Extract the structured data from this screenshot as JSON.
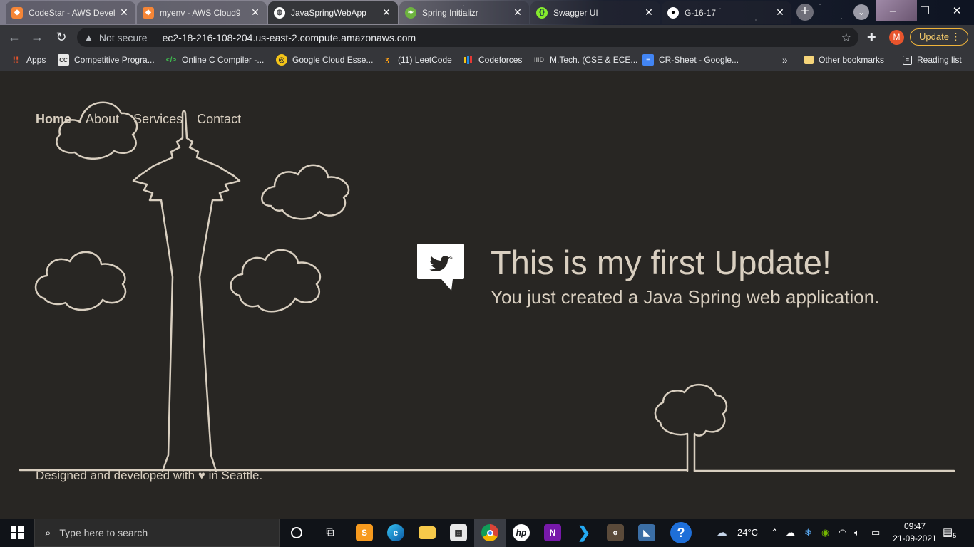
{
  "browser": {
    "tabs": [
      {
        "label": "CodeStar - AWS Devel",
        "icon": "aws-cube-icon",
        "color": "#f58536",
        "active": false
      },
      {
        "label": "myenv - AWS Cloud9",
        "icon": "aws-cube-icon",
        "color": "#f58536",
        "active": false
      },
      {
        "label": "JavaSpringWebApp",
        "icon": "globe-icon",
        "color": "#ffffff",
        "active": true
      },
      {
        "label": "Spring Initializr",
        "icon": "spring-leaf-icon",
        "color": "#6db33f",
        "active": false
      },
      {
        "label": "Swagger UI",
        "icon": "swagger-icon",
        "color": "#85ea2d",
        "active": false
      },
      {
        "label": "G-16-17",
        "icon": "github-icon",
        "color": "#ffffff",
        "active": false
      }
    ],
    "new_tab": "+",
    "window_controls": {
      "minimize": "–",
      "maximize": "❐",
      "close": "✕"
    },
    "address": {
      "security_label": "Not secure",
      "url": "ec2-18-216-108-204.us-east-2.compute.amazonaws.com"
    },
    "profile_initial": "M",
    "update_label": "Update",
    "bookmarks": [
      {
        "label": "Apps",
        "icon": "apps-grid-icon"
      },
      {
        "label": "Competitive Progra...",
        "icon": "cc-icon"
      },
      {
        "label": "Online C Compiler -...",
        "icon": "code-brackets-icon"
      },
      {
        "label": "Google Cloud Esse...",
        "icon": "qwiklabs-icon"
      },
      {
        "label": "(11) LeetCode",
        "icon": "leetcode-icon"
      },
      {
        "label": "Codeforces",
        "icon": "codeforces-icon"
      },
      {
        "label": "M.Tech. (CSE & ECE...",
        "icon": "iiitd-icon"
      },
      {
        "label": "CR-Sheet - Google...",
        "icon": "google-sheets-icon"
      }
    ],
    "bookmarks_overflow": "»",
    "other_bookmarks": "Other bookmarks",
    "reading_list": "Reading list"
  },
  "site": {
    "nav": [
      {
        "label": "Home",
        "current": true
      },
      {
        "label": "About",
        "current": false
      },
      {
        "label": "Services",
        "current": false
      },
      {
        "label": "Contact",
        "current": false
      }
    ],
    "hero_title": "This is my first Update!",
    "hero_subtitle": "You just created a Java Spring web application.",
    "footer": "Designed and developed with ♥ in Seattle.",
    "colors": {
      "background": "#282623",
      "line_art": "#d9cfc0"
    }
  },
  "taskbar": {
    "search_placeholder": "Type here to search",
    "apps": [
      {
        "name": "cortana",
        "icon": "cortana-circle-icon"
      },
      {
        "name": "task-view",
        "icon": "task-view-icon"
      },
      {
        "name": "sublime-text",
        "icon": "sublime-icon"
      },
      {
        "name": "edge",
        "icon": "edge-icon"
      },
      {
        "name": "file-explorer",
        "icon": "folder-icon"
      },
      {
        "name": "store",
        "icon": "store-bag-icon"
      },
      {
        "name": "chrome",
        "icon": "chrome-icon"
      },
      {
        "name": "hp",
        "icon": "hp-icon"
      },
      {
        "name": "onenote",
        "icon": "onenote-icon"
      },
      {
        "name": "vscode",
        "icon": "vscode-icon"
      },
      {
        "name": "game",
        "icon": "game-icon"
      },
      {
        "name": "mysql-workbench",
        "icon": "workbench-icon"
      },
      {
        "name": "help",
        "icon": "help-icon"
      }
    ],
    "weather": "24°C",
    "time": "09:47",
    "date": "21-09-2021",
    "notifications": "5"
  }
}
